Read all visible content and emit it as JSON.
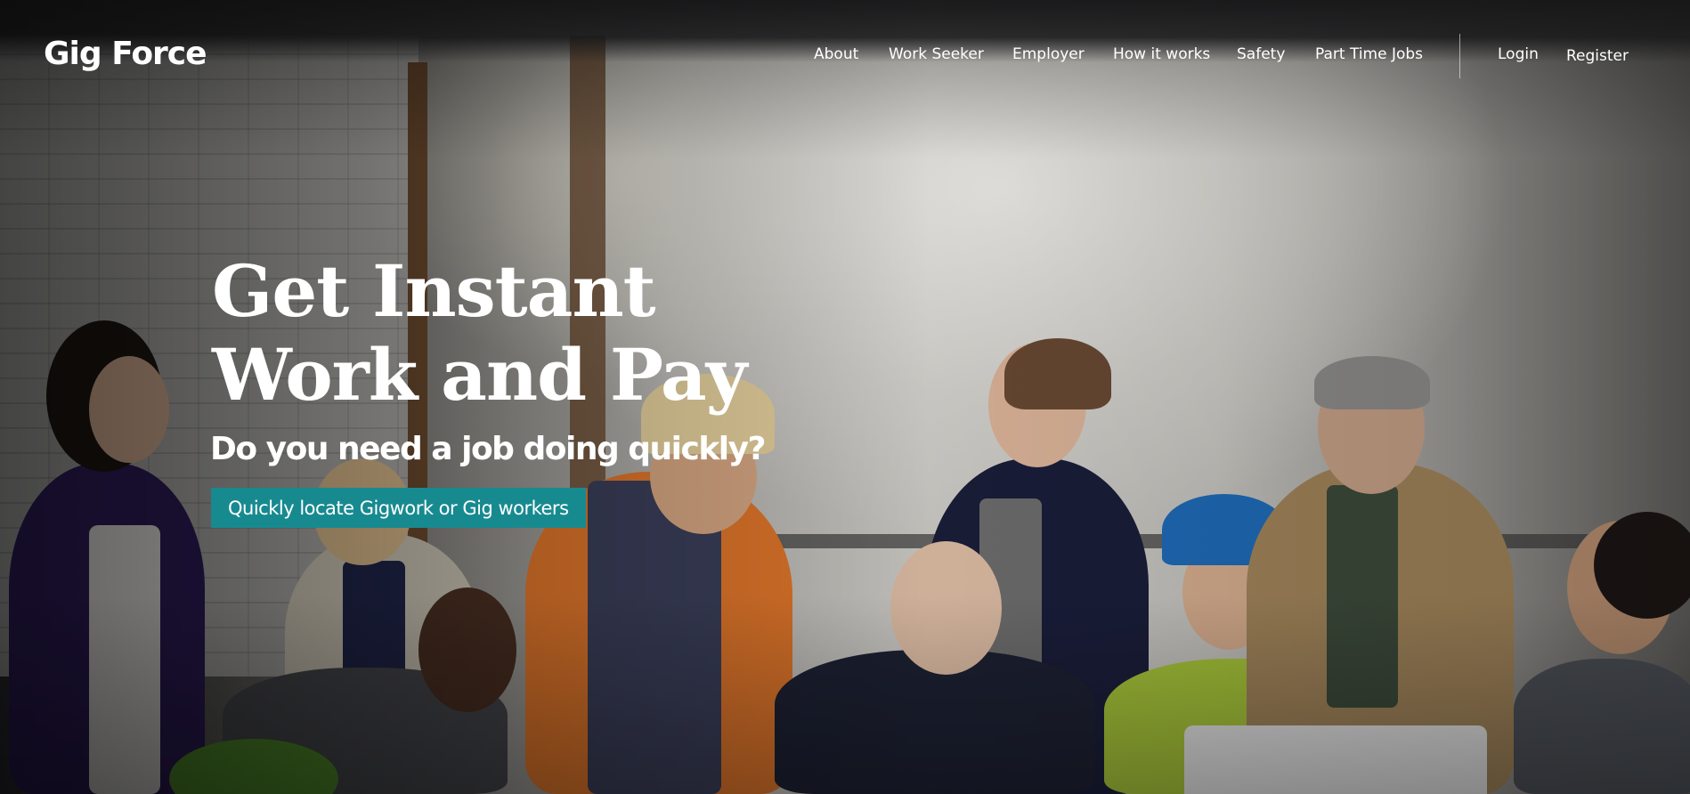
{
  "header": {
    "logo": "Gig Force",
    "nav": [
      {
        "label": "About"
      },
      {
        "label": "Work Seeker"
      },
      {
        "label": "Employer"
      },
      {
        "label": "How it works"
      },
      {
        "label": "Safety"
      },
      {
        "label": "Part Time Jobs"
      }
    ],
    "login_label": "Login",
    "register_label": "Register"
  },
  "hero": {
    "headline_line1": "Get Instant",
    "headline_line2": "Work and Pay",
    "subheadline": "Do you need a job doing quickly?",
    "cta_label": "Quickly locate Gigwork or Gig workers"
  },
  "colors": {
    "accent": "#178a90",
    "text": "#ffffff"
  }
}
